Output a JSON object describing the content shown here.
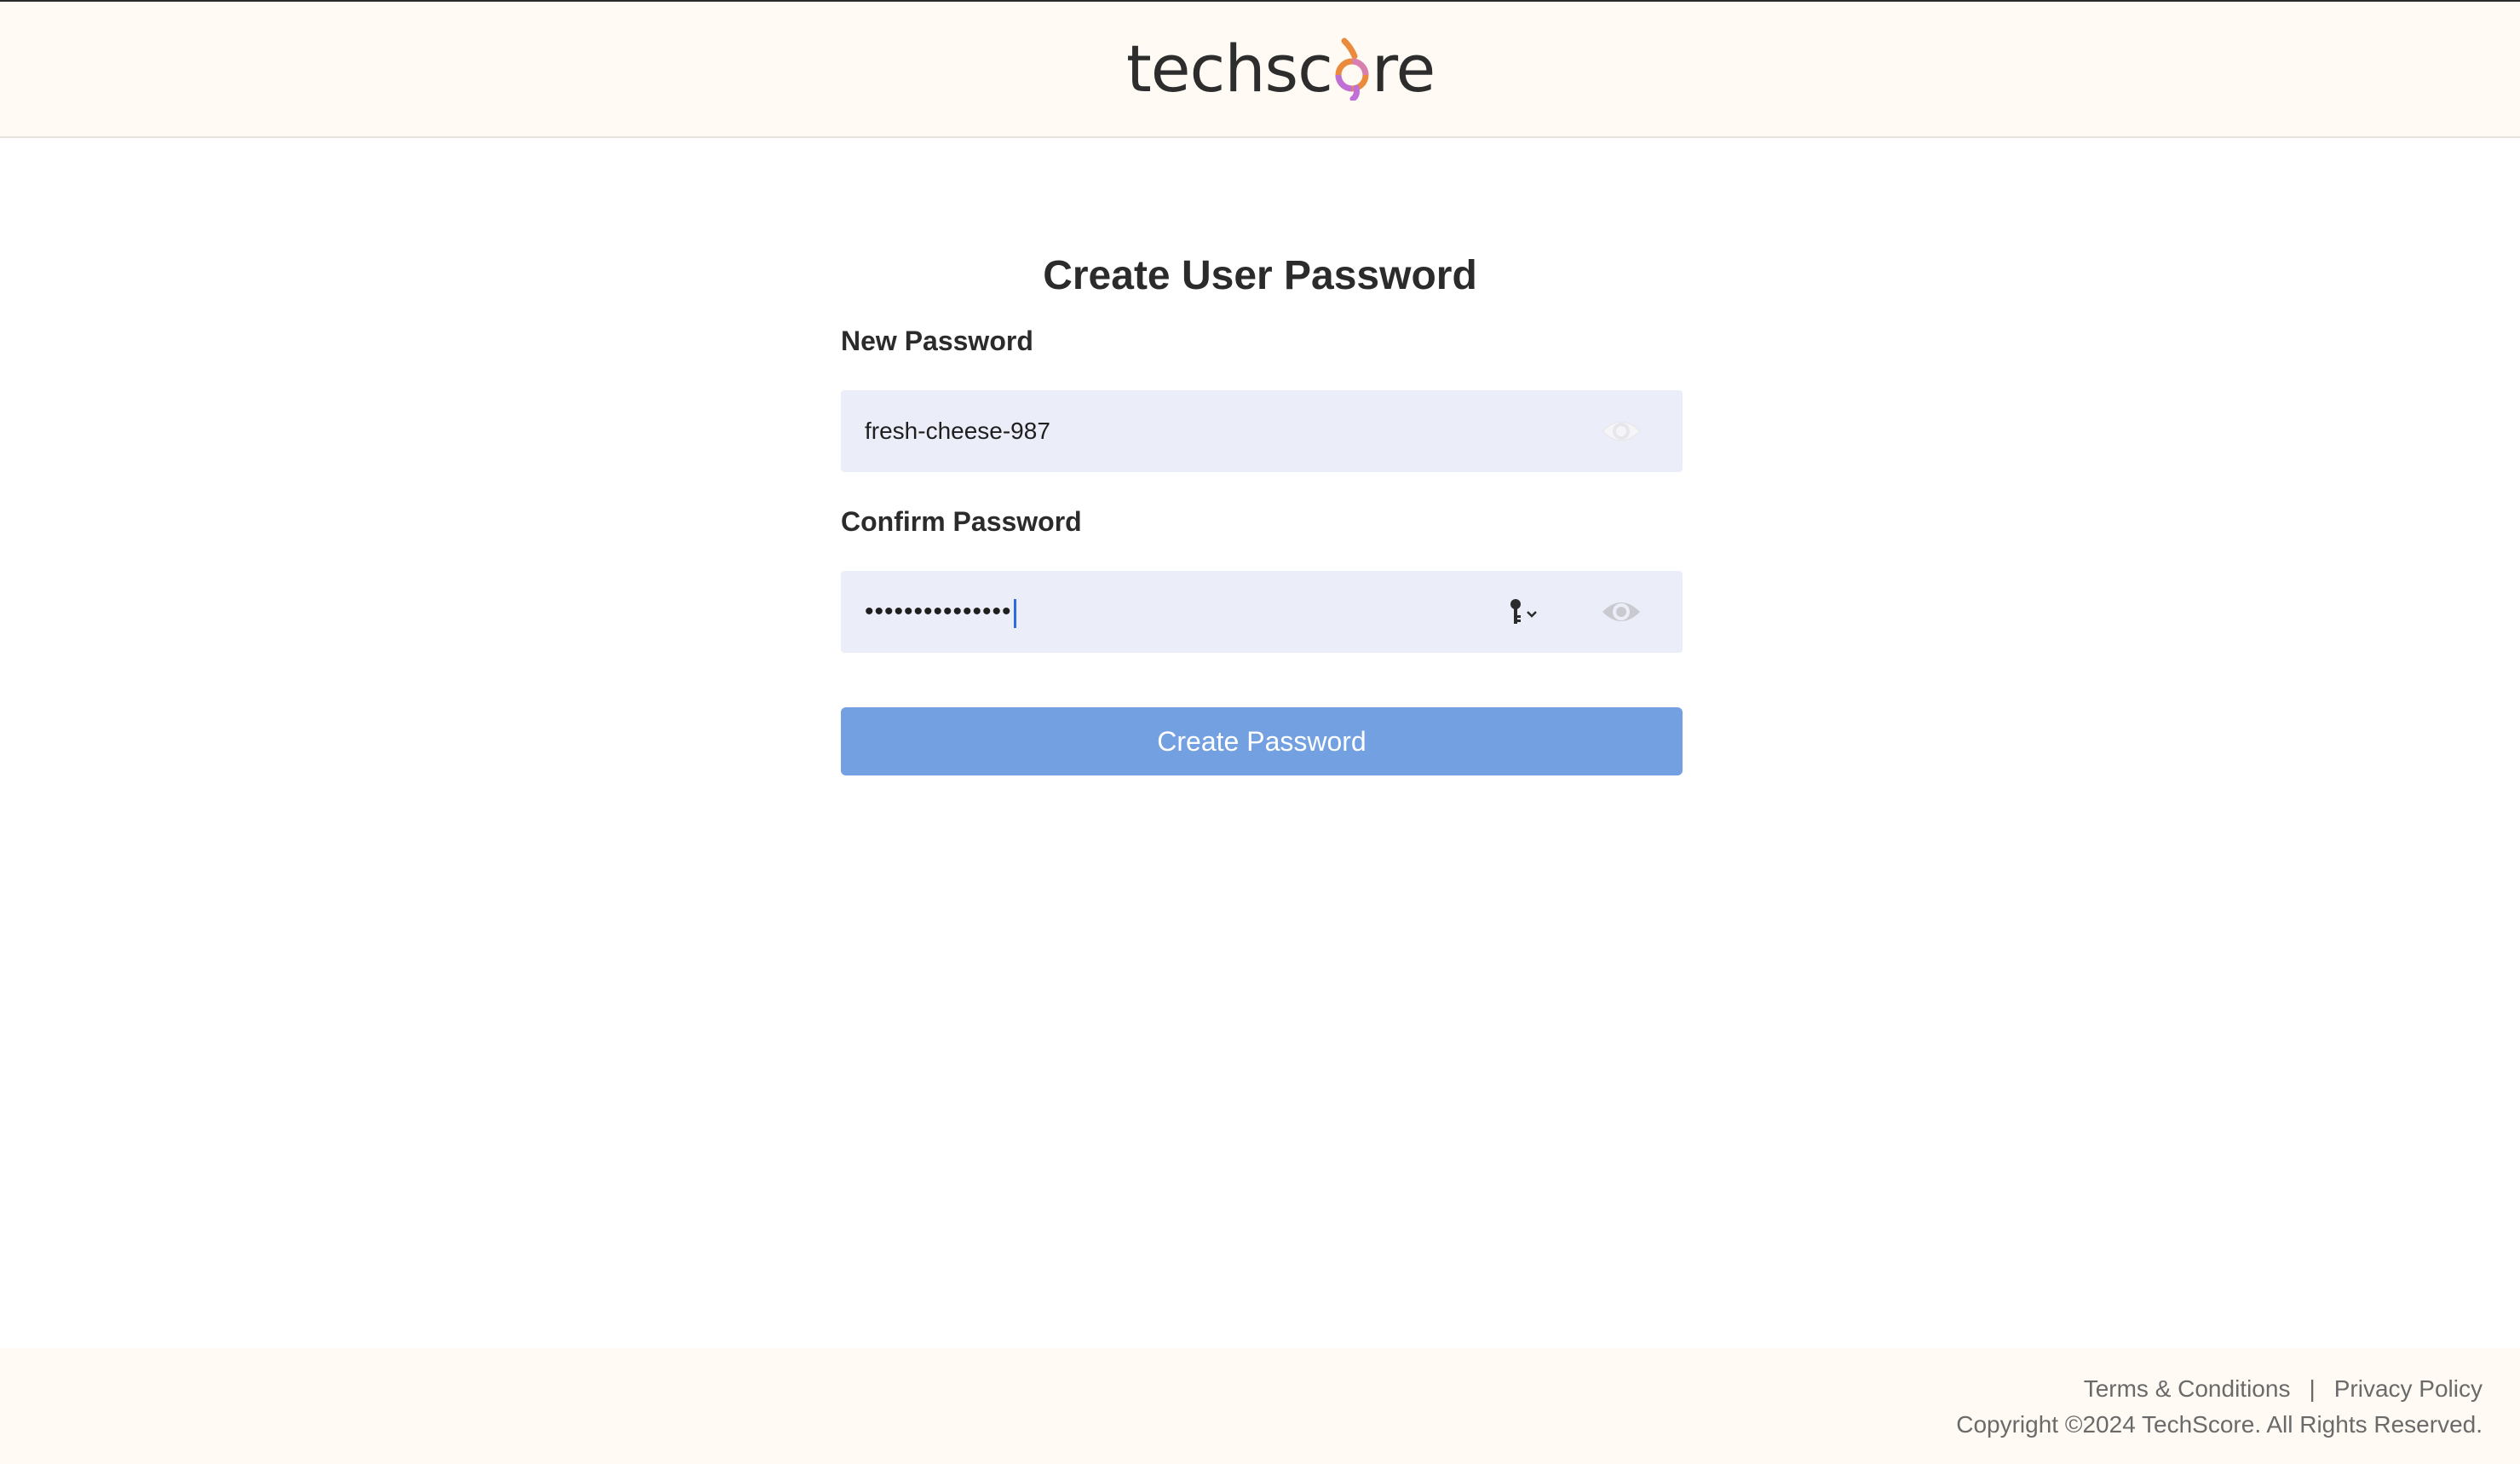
{
  "header": {
    "logo_prefix": "techsc",
    "logo_suffix": "re",
    "logo_accent_colors": [
      "#e98a3c",
      "#c06fd6"
    ]
  },
  "form": {
    "title": "Create User Password",
    "new_password": {
      "label": "New Password",
      "value": "fresh-cheese-987",
      "toggle_icon": "eye-icon"
    },
    "confirm_password": {
      "label": "Confirm Password",
      "masked_value": "•••••••••••••••",
      "toggle_icon": "eye-icon",
      "autofill_icon": "key-icon"
    },
    "submit_label": "Create Password",
    "submit_color": "#72a0e1"
  },
  "footer": {
    "terms": "Terms & Conditions",
    "separator": "|",
    "privacy": "Privacy Policy",
    "copyright": "Copyright ©2024 TechScore. All Rights Reserved."
  }
}
